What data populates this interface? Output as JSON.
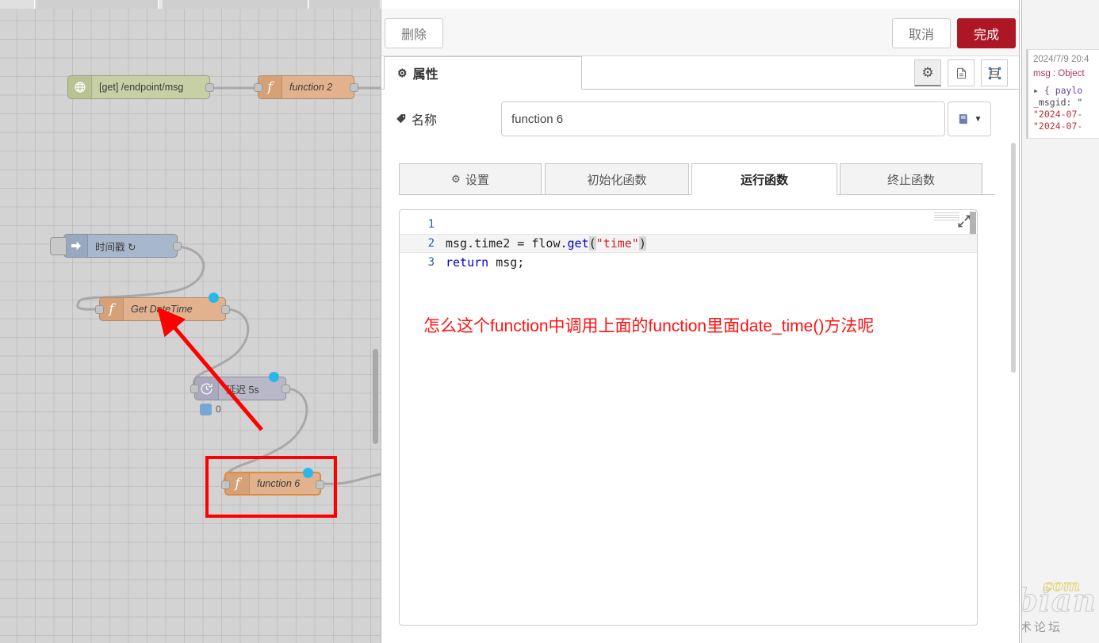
{
  "canvas": {
    "nodes": [
      {
        "id": "http-in",
        "label": "[get] /endpoint/msg",
        "icon": "globe-icon"
      },
      {
        "id": "function2",
        "label": "function 2",
        "icon": "function-icon"
      },
      {
        "id": "inject",
        "label": "时间戳 ↻",
        "icon": "inject-arrow-icon"
      },
      {
        "id": "getdatetime",
        "label": "Get DateTime",
        "icon": "function-icon"
      },
      {
        "id": "delay",
        "label": "延迟 5s",
        "icon": "clock-icon",
        "status": "0"
      },
      {
        "id": "function6",
        "label": "function 6",
        "icon": "function-icon"
      }
    ]
  },
  "dialog": {
    "delete_label": "删除",
    "cancel_label": "取消",
    "done_label": "完成",
    "tab_properties": "属性",
    "icon_buttons": [
      "gear-icon",
      "description-icon",
      "appearance-icon"
    ],
    "name_label": "名称",
    "name_value": "function 6",
    "name_placeholder": "名称",
    "library_icon": "library-icon",
    "function_tabs": [
      {
        "label": "设置",
        "icon": "gear-icon",
        "active": false
      },
      {
        "label": "初始化函数",
        "icon": "",
        "active": false
      },
      {
        "label": "运行函数",
        "icon": "",
        "active": true
      },
      {
        "label": "终止函数",
        "icon": "",
        "active": false
      }
    ]
  },
  "editor": {
    "lines": [
      {
        "num": "1",
        "text": ""
      },
      {
        "num": "2",
        "text": "msg.time2 = flow.get(\"time\")"
      },
      {
        "num": "3",
        "text": "return msg;"
      }
    ],
    "line2_tokens": {
      "prop": "msg.time2 = flow.",
      "fn": "get",
      "open": "(",
      "str": "\"time\"",
      "close": ")"
    },
    "line3_tokens": {
      "kw": "return",
      "rest": " msg;"
    },
    "expand_icon": "expand-icon"
  },
  "annotation": {
    "text": "怎么这个function中调用上面的function里面date_time()方法呢",
    "color": "#ff1111",
    "arrow_color": "#ff0000",
    "highlight_box_color": "#ff0000"
  },
  "sidebar": {
    "debug": {
      "timestamp": "2024/7/9 20:4",
      "topic": "msg : Object",
      "lines": [
        "▸ { paylo",
        "_msgid: \"",
        "\"2024-07-",
        "\"2024-07-"
      ]
    }
  },
  "watermark": {
    "main": "Hassbian",
    "suffix": "com",
    "sub": "瀚思彼岸技术论坛"
  },
  "colors": {
    "done_button": "#ad1625",
    "node_function": "#e2b28e",
    "node_http": "#c7cfa4",
    "node_inject": "#a8b8cc",
    "node_delay": "#b9b8c9",
    "selection": "#e08a3c",
    "port_dot": "#29b7e8"
  }
}
